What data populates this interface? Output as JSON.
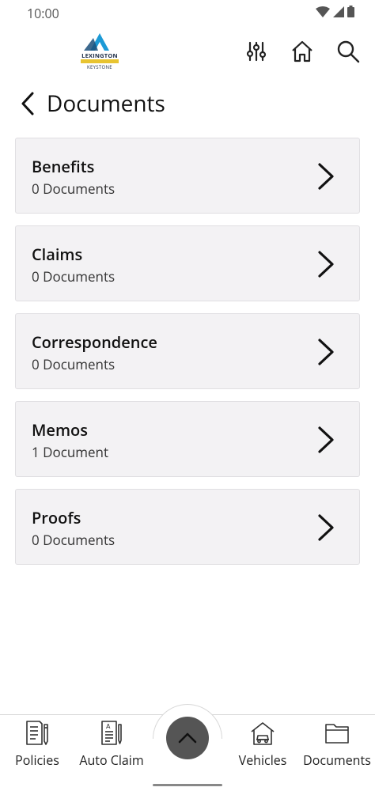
{
  "status_bar": {
    "time": "10:00"
  },
  "header": {
    "logo": {
      "line1": "LEXINGTON",
      "line2": "KEYSTONE",
      "accent": "#1c9ad6",
      "band": "#e8c431"
    },
    "icons": [
      "filter-sliders-icon",
      "home-icon",
      "search-icon"
    ]
  },
  "page": {
    "title": "Documents"
  },
  "documents": [
    {
      "name": "Benefits",
      "count": "0 Documents"
    },
    {
      "name": "Claims",
      "count": "0 Documents"
    },
    {
      "name": "Correspondence",
      "count": "0 Documents"
    },
    {
      "name": "Memos",
      "count": "1 Document"
    },
    {
      "name": "Proofs",
      "count": "0 Documents"
    }
  ],
  "bottom_nav": {
    "items": [
      {
        "label": "Policies",
        "icon": "policy-document-icon"
      },
      {
        "label": "Auto Claim",
        "icon": "auto-claim-icon"
      },
      {
        "label": "Vehicles",
        "icon": "vehicle-garage-icon"
      },
      {
        "label": "Documents",
        "icon": "folder-icon"
      }
    ],
    "fab_icon": "chevron-up-icon",
    "fab_color": "#555555"
  }
}
